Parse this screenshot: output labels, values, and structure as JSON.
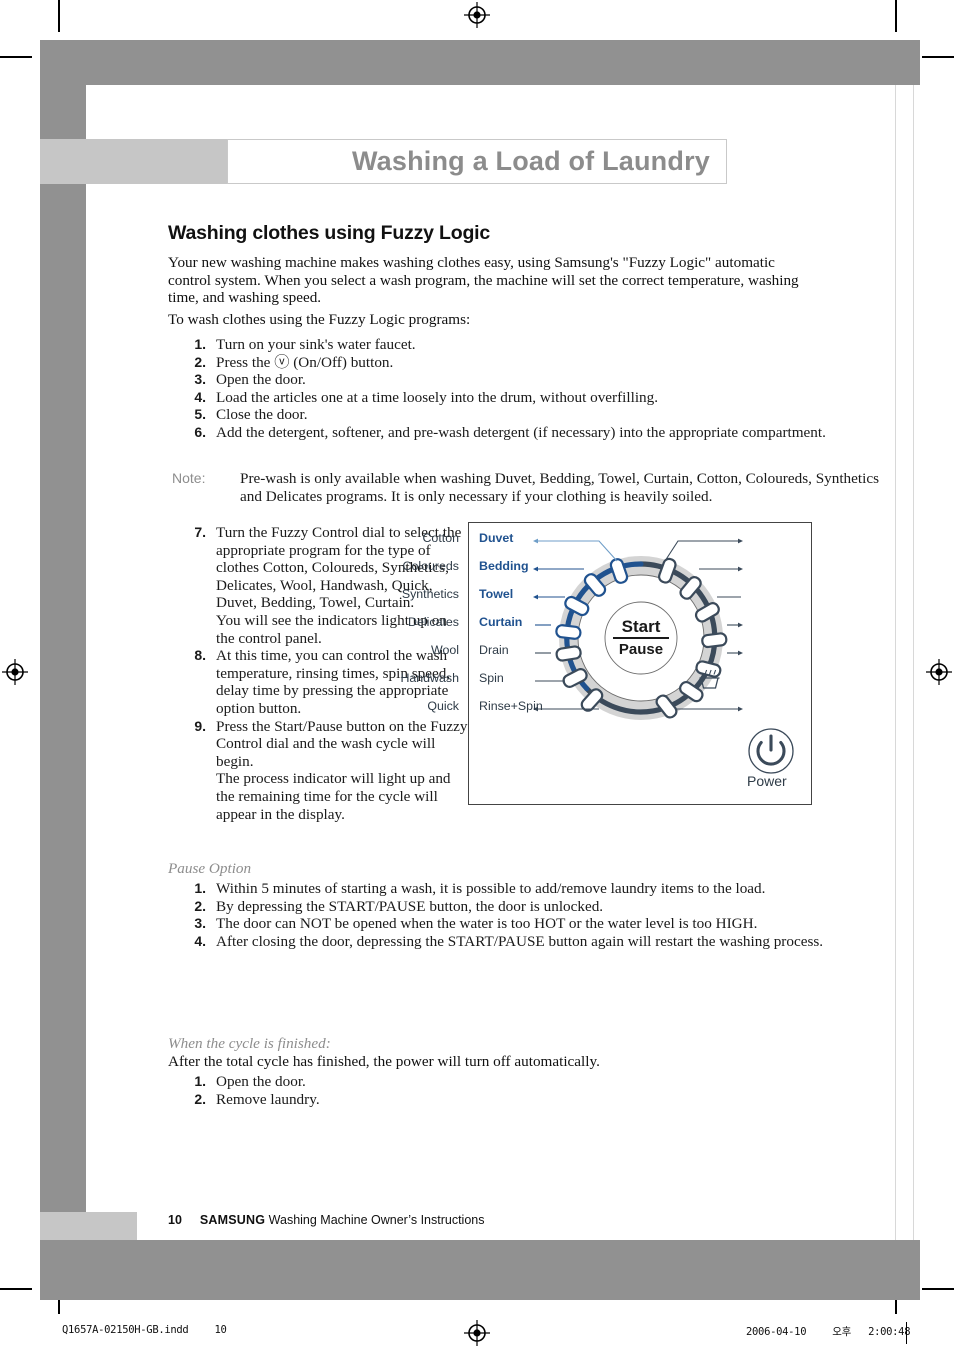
{
  "chapter": {
    "title": "Washing a Load of Laundry"
  },
  "section": {
    "heading": "Washing clothes using Fuzzy Logic",
    "intro": "Your new washing machine makes washing clothes easy, using Samsung's \"Fuzzy Logic\" automatic control system.  When you select a wash program, the machine will set the correct temperature, washing time, and washing speed.",
    "lead_in": "To wash clothes using the Fuzzy Logic programs:"
  },
  "main_steps": [
    {
      "num": "1.",
      "text": "Turn on your sink's water faucet."
    },
    {
      "num": "2.",
      "text": "Press the ⓥ (On/Off) button."
    },
    {
      "num": "3.",
      "text": "Open the door."
    },
    {
      "num": "4.",
      "text": "Load the articles one at a time loosely into the drum, without overfilling."
    },
    {
      "num": "5.",
      "text": "Close the door."
    },
    {
      "num": "6.",
      "text": "Add the detergent, softener, and pre-wash detergent (if necessary) into the appropriate compartment."
    }
  ],
  "note": {
    "label": "Note:",
    "text": "Pre-wash is only available when washing Duvet, Bedding, Towel, Curtain, Cotton, Coloureds, Synthetics and Delicates programs. It is only necessary if your clothing is heavily soiled."
  },
  "narrow_steps": [
    {
      "num": "7.",
      "text": "Turn the Fuzzy Control dial to select the appropriate program for the type of clothes Cotton, Coloureds, Synthetics, Delicates, Wool, Handwash, Quick, Duvet, Bedding, Towel, Curtain.\nYou will see the indicators light up on the control panel."
    },
    {
      "num": "8.",
      "text": "At this time, you can control the wash temperature, rinsing times, spin speed, delay time  by pressing the appropriate option button."
    },
    {
      "num": "9.",
      "text": "Press the Start/Pause button on the Fuzzy Control dial and the wash cycle will begin.\nThe process indicator will light up and the remaining time for the cycle will appear in the display."
    }
  ],
  "pause_option": {
    "heading": "Pause Option",
    "steps": [
      {
        "num": "1.",
        "text": "Within 5 minutes of starting a wash, it is possible to add/remove laundry items to the load."
      },
      {
        "num": "2.",
        "text": "By depressing the START/PAUSE button, the door is unlocked."
      },
      {
        "num": "3.",
        "text": "The door can NOT be opened when the water is too HOT or the water level is too HIGH."
      },
      {
        "num": "4.",
        "text": "After closing the door, depressing the START/PAUSE button again will restart the washing process."
      }
    ]
  },
  "cycle_finished": {
    "heading": "When the cycle is finished:",
    "intro": "After the total cycle has finished, the power will turn off automatically.",
    "steps": [
      {
        "num": "1.",
        "text": "Open the door."
      },
      {
        "num": "2.",
        "text": "Remove laundry."
      }
    ]
  },
  "control_panel": {
    "center_line1": "Start",
    "center_line2": "Pause",
    "power_label": "Power",
    "left_labels": [
      {
        "text": "Duvet",
        "highlight": true
      },
      {
        "text": "Bedding",
        "highlight": true
      },
      {
        "text": "Towel",
        "highlight": true
      },
      {
        "text": "Curtain",
        "highlight": true
      },
      {
        "text": "Drain",
        "highlight": false
      },
      {
        "text": "Spin",
        "highlight": false
      },
      {
        "text": "Rinse+Spin",
        "highlight": false
      }
    ],
    "right_labels": [
      {
        "text": "Cotton",
        "icon": ""
      },
      {
        "text": "Coloureds",
        "icon": ""
      },
      {
        "text": "Synthetics",
        "icon": ""
      },
      {
        "text": "Delicates",
        "icon": ""
      },
      {
        "text": "Wool",
        "icon": ""
      },
      {
        "text": "Handwash",
        "icon": "handwash-icon"
      },
      {
        "text": "Quick",
        "icon": ""
      }
    ],
    "colors": {
      "highlight_blue": "#20528f",
      "dial_dark": "#3b4a5a",
      "dial_ring_gray": "#d4d4d4",
      "label_gray": "#2e3b47"
    }
  },
  "footer": {
    "page_number": "10",
    "brand": "SAMSUNG",
    "text": "Washing Machine Owner’s Instructions"
  },
  "production_slug": {
    "filename": "Q1657A-02150H-GB.indd",
    "page": "10",
    "date": "2006-04-10",
    "meridiem": "오후",
    "time": "2:00:48"
  }
}
